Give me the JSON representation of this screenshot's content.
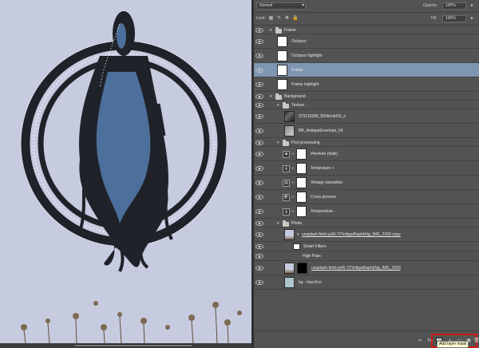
{
  "options": {
    "blend_mode": "Normal",
    "opacity_label": "Opacity:",
    "opacity_value": "100%",
    "lock_label": "Lock:",
    "fill_label": "Fill:",
    "fill_value": "100%"
  },
  "layers": [
    {
      "type": "group",
      "name": "Frame",
      "indent": 0,
      "thumb": "none"
    },
    {
      "type": "layer",
      "name": "Octopus",
      "indent": 1,
      "thumb": "white"
    },
    {
      "type": "layer",
      "name": "Octopus highlight",
      "indent": 1,
      "thumb": "white"
    },
    {
      "type": "layer",
      "name": "Frame",
      "indent": 1,
      "thumb": "white",
      "selected": true
    },
    {
      "type": "layer",
      "name": "Frame highlight",
      "indent": 1,
      "thumb": "white"
    },
    {
      "type": "group",
      "name": "Background",
      "indent": 0,
      "thumb": "none"
    },
    {
      "type": "group",
      "name": "Texture",
      "indent": 1,
      "thumb": "none"
    },
    {
      "type": "layer",
      "name": "373110389_f534bcdd16_o",
      "indent": 2,
      "thumb": "dark"
    },
    {
      "type": "layer",
      "name": "BB_AntiqueEnvelope_04",
      "indent": 2,
      "thumb": "gray"
    },
    {
      "type": "group",
      "name": "Post processing",
      "indent": 1,
      "thumb": "none"
    },
    {
      "type": "adjust",
      "name": "#4e4e4e (fade)",
      "indent": 2,
      "thumb": "white"
    },
    {
      "type": "adjust",
      "name": "Temprature +",
      "indent": 2,
      "thumb": "white",
      "adj_icon": "🌡"
    },
    {
      "type": "adjust",
      "name": "Vintage saturation",
      "indent": 2,
      "thumb": "white",
      "adj_icon": "▤"
    },
    {
      "type": "adjust",
      "name": "Cross process",
      "indent": 2,
      "thumb": "white",
      "adj_icon": "◩"
    },
    {
      "type": "adjust",
      "name": "Temperature -",
      "indent": 2,
      "thumb": "white",
      "adj_icon": "🌡"
    },
    {
      "type": "group",
      "name": "Photo",
      "indent": 1,
      "thumb": "none"
    },
    {
      "type": "smart",
      "name": "unsplash-field-ysRL7l7lmligaiRaphkNg_IMG_2200 copy",
      "indent": 2,
      "thumb": "smart"
    },
    {
      "type": "filter",
      "name": "Smart Filters",
      "indent": 3,
      "thumb": "white"
    },
    {
      "type": "filter-item",
      "name": "High Pass",
      "indent": 3,
      "thumb": "none"
    },
    {
      "type": "layer",
      "name": "unsplash-field-ysRL7l7lmligaiRaphkNg_IMG_2200",
      "indent": 2,
      "thumb": "photo-mask"
    },
    {
      "type": "layer",
      "name": "bg - #acc5ce",
      "indent": 2,
      "thumb": "bgcolor"
    }
  ],
  "bottom": {
    "icons": [
      "link-icon",
      "fx-icon",
      "add-mask-icon",
      "adjustment-icon",
      "folder-icon",
      "new-layer-icon",
      "trash-icon"
    ],
    "tooltip": "Add layer mask"
  },
  "colors": {
    "canvas_bg": "#c7cbe0",
    "ink": "#1f2228",
    "octopus_blue": "#4c6f9b",
    "selected_row": "#7f96b2",
    "bg_swatch": "#acc5ce",
    "highlight_red": "#d01818"
  }
}
